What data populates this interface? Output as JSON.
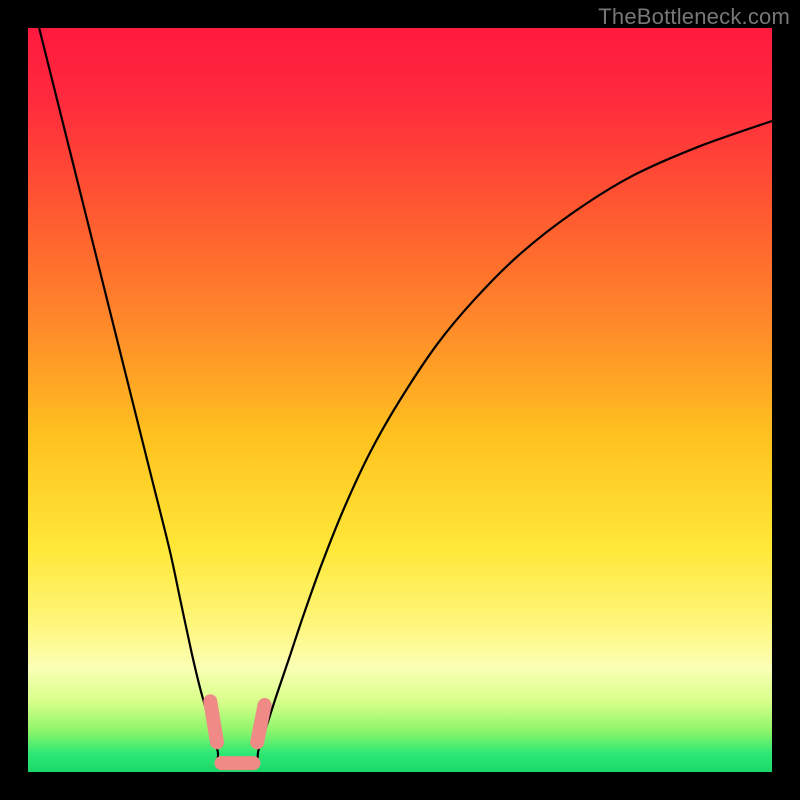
{
  "watermark": "TheBottleneck.com",
  "chart_data": {
    "type": "line",
    "title": "",
    "xlabel": "",
    "ylabel": "",
    "xlim": [
      0,
      100
    ],
    "ylim": [
      0,
      100
    ],
    "grid": false,
    "gradient_stops": [
      {
        "offset": 0.0,
        "color": "#ff1a3f"
      },
      {
        "offset": 0.1,
        "color": "#ff2b3d"
      },
      {
        "offset": 0.25,
        "color": "#ff5a30"
      },
      {
        "offset": 0.4,
        "color": "#ff8a2a"
      },
      {
        "offset": 0.55,
        "color": "#ffc21f"
      },
      {
        "offset": 0.7,
        "color": "#ffe838"
      },
      {
        "offset": 0.8,
        "color": "#fff67a"
      },
      {
        "offset": 0.86,
        "color": "#fbffb5"
      },
      {
        "offset": 0.905,
        "color": "#d8ff8a"
      },
      {
        "offset": 0.945,
        "color": "#8cf56a"
      },
      {
        "offset": 0.975,
        "color": "#2fe874"
      },
      {
        "offset": 1.0,
        "color": "#18d86a"
      }
    ],
    "series": [
      {
        "name": "left-branch",
        "color": "#000000",
        "width": 2.2,
        "x": [
          1.5,
          4,
          6.5,
          9,
          11.5,
          14,
          16.5,
          19,
          20.5,
          22,
          23.2,
          24.2,
          24.9,
          25.5,
          26.0
        ],
        "y": [
          100,
          90,
          80,
          70,
          60,
          50,
          40,
          30,
          23,
          16,
          11,
          7.5,
          4.8,
          2.8,
          1.0
        ]
      },
      {
        "name": "right-branch",
        "color": "#000000",
        "width": 2.2,
        "x": [
          30.3,
          31.0,
          32.0,
          33.3,
          35.0,
          37.0,
          39.5,
          42.5,
          46.0,
          50.0,
          55.0,
          60.0,
          66.0,
          73.0,
          81.0,
          90.0,
          100.0
        ],
        "y": [
          1.0,
          3.0,
          6.0,
          10.0,
          15.0,
          21.0,
          28.0,
          35.5,
          43.0,
          50.0,
          57.5,
          63.5,
          69.5,
          75.0,
          80.0,
          84.0,
          87.5
        ]
      }
    ],
    "valley_floor": {
      "x": [
        26.0,
        30.3
      ],
      "y": [
        1.0,
        1.0
      ]
    },
    "markers": {
      "color": "#f08a86",
      "cap_radius": 7,
      "stroke_width": 14,
      "left": {
        "x1": 24.5,
        "y1": 9.5,
        "x2": 25.4,
        "y2": 4.0
      },
      "right": {
        "x1": 30.8,
        "y1": 4.0,
        "x2": 31.8,
        "y2": 9.0
      },
      "base": {
        "x1": 26.0,
        "y1": 1.2,
        "x2": 30.3,
        "y2": 1.2
      }
    }
  }
}
